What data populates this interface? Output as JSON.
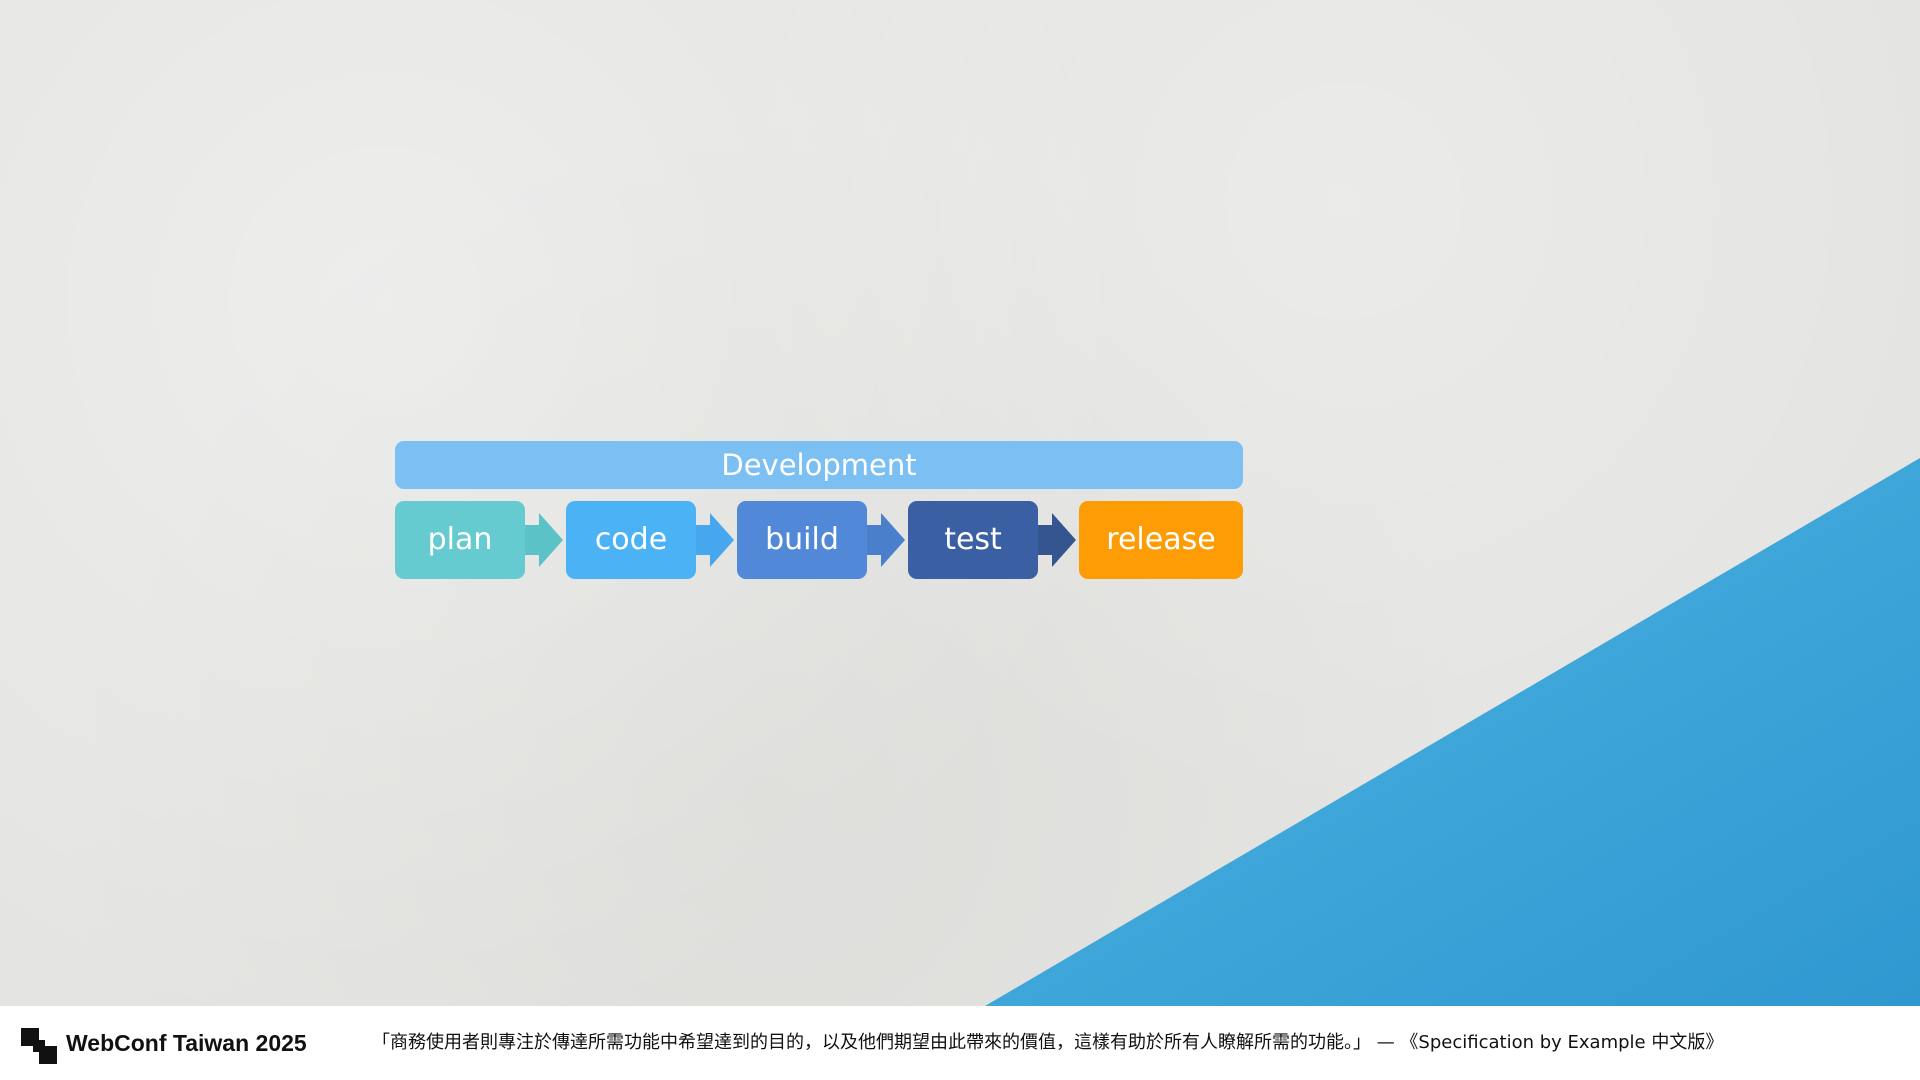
{
  "diagram": {
    "group_label": "Development",
    "stages": [
      "plan",
      "code",
      "build",
      "test",
      "release"
    ]
  },
  "footer": {
    "brand": "WebConf Taiwan 2025",
    "quote": "「商務使用者則專注於傳達所需功能中希望達到的目的，以及他們期望由此帶來的價值，這樣有助於所有人瞭解所需的功能。」 — 《Specification by Example 中文版》"
  },
  "colors": {
    "development_bar": "#7cbff2",
    "plan": "#66cbd0",
    "code": "#4ab2f5",
    "build": "#5189d8",
    "test": "#3b5fa3",
    "release": "#fe9c06",
    "blue_wedge": "#3aa3d8",
    "background": "#e4e4e2"
  },
  "icons": {
    "logo": "webconf-logo-icon",
    "arrows": "chevron-right-icon"
  }
}
